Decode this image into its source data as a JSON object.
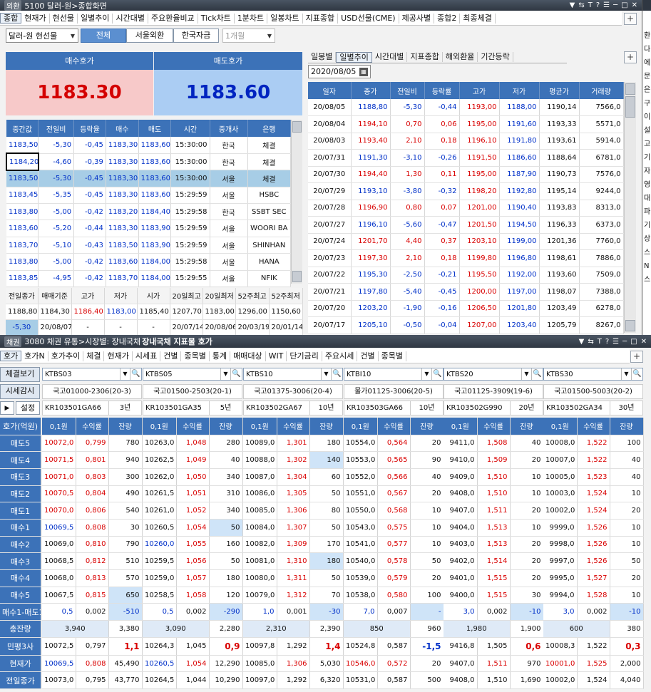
{
  "top": {
    "title": "5100 달러-원>종합화면",
    "logo": "외환",
    "tabs": [
      "종합",
      "현재가",
      "현선물",
      "일별추이",
      "시간대별",
      "주요환율비교",
      "Tick차트",
      "1분차트",
      "일봉차트",
      "지표종합",
      "USD선물(CME)",
      "제공사별",
      "종합2",
      "최종체결"
    ],
    "currency_select": "달러-원 현선물",
    "seg_buttons": [
      "전체",
      "서울외환",
      "한국자금"
    ],
    "period_select": "1개월",
    "bid_label": "매수호가",
    "ask_label": "매도호가",
    "bid_price": "1183.30",
    "ask_price": "1183.60",
    "tick_headers": [
      "중간값",
      "전일비",
      "등락율",
      "매수",
      "매도",
      "시간",
      "중개사",
      "은행"
    ],
    "tick_rows": [
      [
        "1183,50",
        "-5,30",
        "-0,45",
        "1183,30",
        "1183,60",
        "15:30:00",
        "한국",
        "체결"
      ],
      [
        "1184,20",
        "-4,60",
        "-0,39",
        "1183,30",
        "1183,60",
        "15:30:00",
        "한국",
        "체결"
      ],
      [
        "1183,50",
        "-5,30",
        "-0,45",
        "1183,30",
        "1183,60",
        "15:30:00",
        "서울",
        "체결"
      ],
      [
        "1183,45",
        "-5,35",
        "-0,45",
        "1183,30",
        "1183,60",
        "15:29:59",
        "서울",
        "HSBC"
      ],
      [
        "1183,80",
        "-5,00",
        "-0,42",
        "1183,20",
        "1184,40",
        "15:29:58",
        "한국",
        "SSBT SEC"
      ],
      [
        "1183,60",
        "-5,20",
        "-0,44",
        "1183,30",
        "1183,90",
        "15:29:59",
        "서울",
        "WOORI BA"
      ],
      [
        "1183,70",
        "-5,10",
        "-0,43",
        "1183,50",
        "1183,90",
        "15:29:59",
        "서울",
        "SHINHAN"
      ],
      [
        "1183,80",
        "-5,00",
        "-0,42",
        "1183,60",
        "1184,00",
        "15:29:58",
        "서울",
        "HANA"
      ],
      [
        "1183,85",
        "-4,95",
        "-0,42",
        "1183,70",
        "1184,00",
        "15:29:55",
        "서울",
        "NFIK"
      ]
    ],
    "summary_headers": [
      "전일종가",
      "매매기준",
      "고가",
      "저가",
      "시가",
      "20일최고",
      "20일최저",
      "52주최고",
      "52주최저"
    ],
    "summary_row": [
      "1188,80",
      "1184,30",
      "1186,40",
      "1183,00",
      "1185,40",
      "1207,70",
      "1183,00",
      "1296,00",
      "1150,60"
    ],
    "summary_row2": [
      "-5,30",
      "20/08/07",
      "-",
      "-",
      "-",
      "20/07/14",
      "20/08/06",
      "20/03/19",
      "20/01/14"
    ],
    "right_tabs": [
      "일봉별",
      "일별추이",
      "시간대별",
      "지표종합",
      "해외환율",
      "기간등락"
    ],
    "date": "2020/08/05",
    "daily_headers": [
      "일자",
      "종가",
      "전일비",
      "등락률",
      "고가",
      "저가",
      "평균가",
      "거래량"
    ],
    "daily_rows": [
      [
        "20/08/05",
        "1188,80",
        "-5,30",
        "-0,44",
        "1193,00",
        "1188,00",
        "1190,14",
        "7566,0"
      ],
      [
        "20/08/04",
        "1194,10",
        "0,70",
        "0,06",
        "1195,00",
        "1191,60",
        "1193,33",
        "5571,0"
      ],
      [
        "20/08/03",
        "1193,40",
        "2,10",
        "0,18",
        "1196,10",
        "1191,80",
        "1193,61",
        "5914,0"
      ],
      [
        "20/07/31",
        "1191,30",
        "-3,10",
        "-0,26",
        "1191,50",
        "1186,60",
        "1188,64",
        "6781,0"
      ],
      [
        "20/07/30",
        "1194,40",
        "1,30",
        "0,11",
        "1195,00",
        "1187,90",
        "1190,73",
        "7576,0"
      ],
      [
        "20/07/29",
        "1193,10",
        "-3,80",
        "-0,32",
        "1198,20",
        "1192,80",
        "1195,14",
        "9244,0"
      ],
      [
        "20/07/28",
        "1196,90",
        "0,80",
        "0,07",
        "1201,00",
        "1190,40",
        "1193,83",
        "8313,0"
      ],
      [
        "20/07/27",
        "1196,10",
        "-5,60",
        "-0,47",
        "1201,50",
        "1194,50",
        "1196,33",
        "6373,0"
      ],
      [
        "20/07/24",
        "1201,70",
        "4,40",
        "0,37",
        "1203,10",
        "1199,00",
        "1201,36",
        "7760,0"
      ],
      [
        "20/07/23",
        "1197,30",
        "2,10",
        "0,18",
        "1199,80",
        "1196,80",
        "1198,61",
        "7886,0"
      ],
      [
        "20/07/22",
        "1195,30",
        "-2,50",
        "-0,21",
        "1195,50",
        "1192,00",
        "1193,60",
        "7509,0"
      ],
      [
        "20/07/21",
        "1197,80",
        "-5,40",
        "-0,45",
        "1200,00",
        "1197,00",
        "1198,07",
        "7388,0"
      ],
      [
        "20/07/20",
        "1203,20",
        "-1,90",
        "-0,16",
        "1206,50",
        "1201,80",
        "1203,49",
        "6278,0"
      ],
      [
        "20/07/17",
        "1205,10",
        "-0,50",
        "-0,04",
        "1207,00",
        "1203,40",
        "1205,79",
        "8267,0"
      ]
    ]
  },
  "bottom": {
    "title": "3080 채권 유통>시장별: 장내국채",
    "title_bold": "장내국채 지표물 호가",
    "logo": "채권",
    "tabs": [
      "호가",
      "호가N",
      "호가추이",
      "체결",
      "현재가",
      "시세표",
      "건별",
      "종목별",
      "통계",
      "매매대상",
      "WIT",
      "단기금리",
      "주요시세",
      "건별",
      "종목별"
    ],
    "left_buttons": [
      "체결보기",
      "시세감시",
      "설정",
      "호가(억원)"
    ],
    "row_labels": [
      "매도5",
      "매도4",
      "매도3",
      "매도2",
      "매도1",
      "매수1",
      "매수2",
      "매수3",
      "매수4",
      "매수5",
      "매수1-매도1",
      "총잔량",
      "민평3사",
      "현재가",
      "전일종가"
    ],
    "col_headers": [
      "0,1원",
      "수익률",
      "잔량"
    ],
    "bonds": [
      {
        "code": "KTBS03",
        "name": "국고01000-2306(20-3)",
        "isin": "KR103501GA66",
        "term": "3년",
        "ask": [
          [
            "10072,0",
            "0,799",
            "780"
          ],
          [
            "10071,5",
            "0,801",
            "940"
          ],
          [
            "10071,0",
            "0,803",
            "300"
          ],
          [
            "10070,5",
            "0,804",
            "490"
          ],
          [
            "10070,0",
            "0,806",
            "540"
          ]
        ],
        "bid": [
          [
            "10069,5",
            "0,808",
            "30"
          ],
          [
            "10069,0",
            "0,810",
            "790"
          ],
          [
            "10068,5",
            "0,812",
            "510"
          ],
          [
            "10068,0",
            "0,813",
            "570"
          ],
          [
            "10067,5",
            "0,815",
            "650"
          ]
        ],
        "spread": [
          "0,5",
          "0,002",
          "-510"
        ],
        "total": [
          "3,940",
          "3,380"
        ],
        "minpyeong": [
          "10072,5",
          "0,797",
          "1,1"
        ],
        "current": [
          "10069,5",
          "0,808",
          "45,490"
        ],
        "prev": [
          "10073,0",
          "0,795",
          "43,770"
        ]
      },
      {
        "code": "KTBS05",
        "name": "국고01500-2503(20-1)",
        "isin": "KR103501GA35",
        "term": "5년",
        "ask": [
          [
            "10263,0",
            "1,048",
            "280"
          ],
          [
            "10262,5",
            "1,049",
            "40"
          ],
          [
            "10262,0",
            "1,050",
            "340"
          ],
          [
            "10261,5",
            "1,051",
            "310"
          ],
          [
            "10261,0",
            "1,052",
            "340"
          ]
        ],
        "bid": [
          [
            "10260,5",
            "1,054",
            "50"
          ],
          [
            "10260,0",
            "1,055",
            "160"
          ],
          [
            "10259,5",
            "1,056",
            "50"
          ],
          [
            "10259,0",
            "1,057",
            "180"
          ],
          [
            "10258,5",
            "1,058",
            "120"
          ]
        ],
        "spread": [
          "0,5",
          "0,002",
          "-290"
        ],
        "total": [
          "3,090",
          "2,280"
        ],
        "minpyeong": [
          "10264,3",
          "1,045",
          "0,9"
        ],
        "current": [
          "10260,5",
          "1,054",
          "12,290"
        ],
        "prev": [
          "10264,5",
          "1,044",
          "10,290"
        ]
      },
      {
        "code": "KTBS10",
        "name": "국고01375-3006(20-4)",
        "isin": "KR103502GA67",
        "term": "10년",
        "ask": [
          [
            "10089,0",
            "1,301",
            "180"
          ],
          [
            "10088,0",
            "1,302",
            "140"
          ],
          [
            "10087,0",
            "1,304",
            "60"
          ],
          [
            "10086,0",
            "1,305",
            "50"
          ],
          [
            "10085,0",
            "1,306",
            "80"
          ]
        ],
        "bid": [
          [
            "10084,0",
            "1,307",
            "50"
          ],
          [
            "10082,0",
            "1,309",
            "170"
          ],
          [
            "10081,0",
            "1,310",
            "180"
          ],
          [
            "10080,0",
            "1,311",
            "50"
          ],
          [
            "10079,0",
            "1,312",
            "70"
          ]
        ],
        "spread": [
          "1,0",
          "0,001",
          "-30"
        ],
        "total": [
          "2,310",
          "2,390"
        ],
        "minpyeong": [
          "10097,8",
          "1,292",
          "1,4"
        ],
        "current": [
          "10085,0",
          "1,306",
          "5,030"
        ],
        "prev": [
          "10097,0",
          "1,292",
          "6,320"
        ]
      },
      {
        "code": "KTBI10",
        "name": "물가01125-3006(20-5)",
        "isin": "KR103503GA66",
        "term": "10년",
        "ask": [
          [
            "10554,0",
            "0,564",
            "20"
          ],
          [
            "10553,0",
            "0,565",
            "90"
          ],
          [
            "10552,0",
            "0,566",
            "40"
          ],
          [
            "10551,0",
            "0,567",
            "20"
          ],
          [
            "10550,0",
            "0,568",
            "10"
          ]
        ],
        "bid": [
          [
            "10543,0",
            "0,575",
            "10"
          ],
          [
            "10541,0",
            "0,577",
            "10"
          ],
          [
            "10540,0",
            "0,578",
            "50"
          ],
          [
            "10539,0",
            "0,579",
            "20"
          ],
          [
            "10538,0",
            "0,580",
            "100"
          ]
        ],
        "spread": [
          "7,0",
          "0,007",
          "-"
        ],
        "total": [
          "850",
          "960"
        ],
        "minpyeong": [
          "10524,8",
          "0,587",
          "-1,5"
        ],
        "current": [
          "10546,0",
          "0,572",
          "20"
        ],
        "prev": [
          "10531,0",
          "0,587",
          "500"
        ]
      },
      {
        "code": "KTBS20",
        "name": "국고01125-3909(19-6)",
        "isin": "KR103502G990",
        "term": "20년",
        "ask": [
          [
            "9411,0",
            "1,508",
            "40"
          ],
          [
            "9410,0",
            "1,509",
            "20"
          ],
          [
            "9409,0",
            "1,510",
            "10"
          ],
          [
            "9408,0",
            "1,510",
            "10"
          ],
          [
            "9407,0",
            "1,511",
            "20"
          ]
        ],
        "bid": [
          [
            "9404,0",
            "1,513",
            "10"
          ],
          [
            "9403,0",
            "1,513",
            "20"
          ],
          [
            "9402,0",
            "1,514",
            "20"
          ],
          [
            "9401,0",
            "1,515",
            "20"
          ],
          [
            "9400,0",
            "1,515",
            "30"
          ]
        ],
        "spread": [
          "3,0",
          "0,002",
          "-10"
        ],
        "total": [
          "1,980",
          "1,900"
        ],
        "minpyeong": [
          "9416,8",
          "1,505",
          "0,6"
        ],
        "current": [
          "9407,0",
          "1,511",
          "970"
        ],
        "prev": [
          "9408,0",
          "1,510",
          "1,690"
        ]
      },
      {
        "code": "KTBS30",
        "name": "국고01500-5003(20-2)",
        "isin": "KR103502GA34",
        "term": "30년",
        "ask": [
          [
            "10008,0",
            "1,522",
            "100"
          ],
          [
            "10007,0",
            "1,522",
            "40"
          ],
          [
            "10005,0",
            "1,523",
            "40"
          ],
          [
            "10003,0",
            "1,524",
            "10"
          ],
          [
            "10002,0",
            "1,524",
            "20"
          ]
        ],
        "bid": [
          [
            "9999,0",
            "1,526",
            "10"
          ],
          [
            "9998,0",
            "1,526",
            "10"
          ],
          [
            "9997,0",
            "1,526",
            "50"
          ],
          [
            "9995,0",
            "1,527",
            "20"
          ],
          [
            "9994,0",
            "1,528",
            "10"
          ]
        ],
        "spread": [
          "3,0",
          "0,002",
          "-10"
        ],
        "total": [
          "600",
          "380"
        ],
        "minpyeong": [
          "10008,3",
          "1,522",
          "0,3"
        ],
        "current": [
          "10001,0",
          "1,525",
          "2,000"
        ],
        "prev": [
          "10002,0",
          "1,524",
          "4,040"
        ]
      }
    ]
  },
  "side": {
    "chars": [
      "환",
      "다",
      "에",
      "문",
      "은",
      "구",
      "이",
      "설",
      "고",
      "기",
      "자",
      "영",
      "대",
      "파",
      "기",
      "상",
      "스",
      "N",
      "스"
    ]
  }
}
